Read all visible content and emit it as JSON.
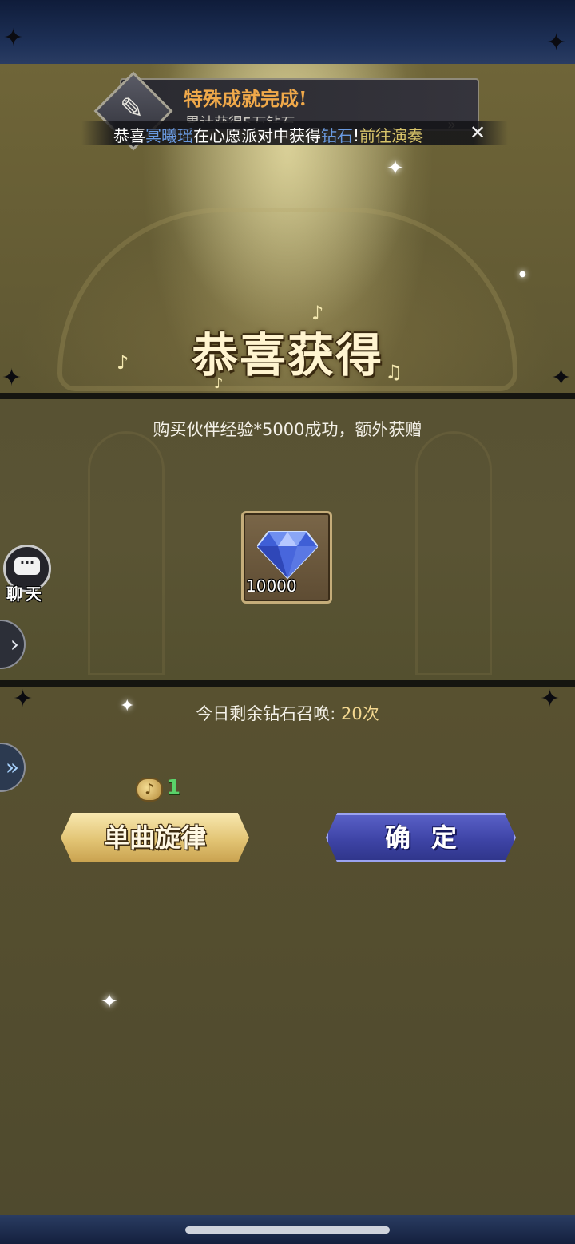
{
  "notification": {
    "title": "特殊成就完成!",
    "subtitle": "累计获得5万钻石"
  },
  "marquee": {
    "prefix": "恭喜",
    "player": "冥曦瑶",
    "middle": "在心愿派对中获得",
    "item": "钻石",
    "bang": "!",
    "link": "前往演奏",
    "close_icon": "✕"
  },
  "reward": {
    "title": "恭喜获得",
    "purchase_text": "购买伙伴经验*5000成功，额外获赠",
    "item_name": "diamond-icon",
    "item_quantity": "10000"
  },
  "chat": {
    "label": "聊天"
  },
  "summon": {
    "label": "今日剩余钻石召唤:",
    "count": "20次"
  },
  "cost": {
    "icon": "music-note-coin-icon",
    "amount": "1"
  },
  "buttons": {
    "single_label": "单曲旋律",
    "confirm_label": "确定"
  },
  "colors": {
    "gold_button": "#e2c474",
    "blue_button": "#3e44a6",
    "title_orange": "#f0a94a",
    "player_blue": "#6a9ae0",
    "link_gold": "#d8c46a",
    "cost_green": "#5ad26a"
  }
}
